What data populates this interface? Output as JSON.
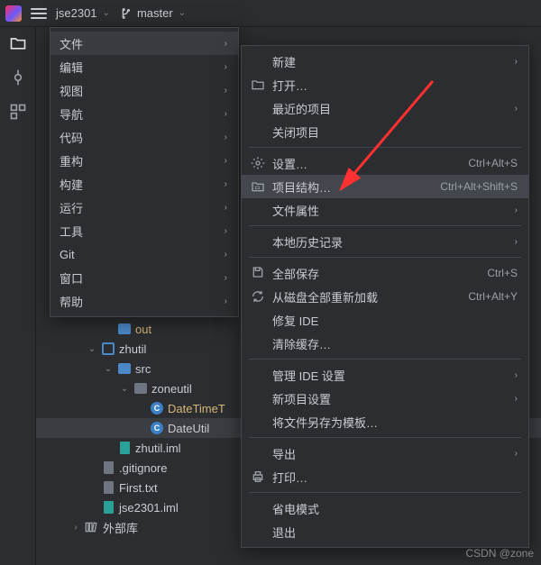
{
  "top": {
    "project": "jse2301",
    "branch": "master"
  },
  "menu1": {
    "items": [
      {
        "label": "文件",
        "arrow": true,
        "hl": true
      },
      {
        "label": "编辑",
        "arrow": true
      },
      {
        "label": "视图",
        "arrow": true
      },
      {
        "label": "导航",
        "arrow": true
      },
      {
        "label": "代码",
        "arrow": true
      },
      {
        "label": "重构",
        "arrow": true
      },
      {
        "label": "构建",
        "arrow": true
      },
      {
        "label": "运行",
        "arrow": true
      },
      {
        "label": "工具",
        "arrow": true
      },
      {
        "label": "Git",
        "arrow": true
      },
      {
        "label": "窗口",
        "arrow": true
      },
      {
        "label": "帮助",
        "arrow": true
      }
    ]
  },
  "menu2": {
    "groups": [
      [
        {
          "icon": "",
          "label": "新建",
          "arrow": true
        },
        {
          "icon": "folder",
          "label": "打开…"
        },
        {
          "icon": "",
          "label": "最近的项目",
          "arrow": true
        },
        {
          "icon": "",
          "label": "关闭项目"
        }
      ],
      [
        {
          "icon": "gear",
          "label": "设置…",
          "short": "Ctrl+Alt+S"
        },
        {
          "icon": "struct",
          "label": "项目结构…",
          "short": "Ctrl+Alt+Shift+S",
          "hl": true
        },
        {
          "icon": "",
          "label": "文件属性",
          "arrow": true
        }
      ],
      [
        {
          "icon": "",
          "label": "本地历史记录",
          "arrow": true
        }
      ],
      [
        {
          "icon": "saveall",
          "label": "全部保存",
          "short": "Ctrl+S"
        },
        {
          "icon": "reload",
          "label": "从磁盘全部重新加载",
          "short": "Ctrl+Alt+Y"
        },
        {
          "icon": "",
          "label": "修复 IDE"
        },
        {
          "icon": "",
          "label": "清除缓存…"
        }
      ],
      [
        {
          "icon": "",
          "label": "管理 IDE 设置",
          "arrow": true
        },
        {
          "icon": "",
          "label": "新项目设置",
          "arrow": true
        },
        {
          "icon": "",
          "label": "将文件另存为模板…"
        }
      ],
      [
        {
          "icon": "",
          "label": "导出",
          "arrow": true
        },
        {
          "icon": "print",
          "label": "打印…"
        }
      ],
      [
        {
          "icon": "",
          "label": "省电模式"
        },
        {
          "icon": "",
          "label": "退出"
        }
      ]
    ]
  },
  "tree": {
    "rows": [
      {
        "depth": 3,
        "arrow": "",
        "icon": "folder-blue",
        "label": "out",
        "yellow": true
      },
      {
        "depth": 2,
        "arrow": "v",
        "icon": "module",
        "label": "zhutil",
        "sel": false
      },
      {
        "depth": 3,
        "arrow": "v",
        "icon": "folder-blue",
        "label": "src"
      },
      {
        "depth": 4,
        "arrow": "v",
        "icon": "folder",
        "label": "zoneutil"
      },
      {
        "depth": 5,
        "arrow": "",
        "icon": "class",
        "label": "DateTimeT",
        "yellow": true
      },
      {
        "depth": 5,
        "arrow": "",
        "icon": "class",
        "label": "DateUtil",
        "sel": true
      },
      {
        "depth": 3,
        "arrow": "",
        "icon": "file-teal",
        "label": "zhutil.iml"
      },
      {
        "depth": 2,
        "arrow": "",
        "icon": "file-gray",
        "label": ".gitignore"
      },
      {
        "depth": 2,
        "arrow": "",
        "icon": "file-gray",
        "label": "First.txt"
      },
      {
        "depth": 2,
        "arrow": "",
        "icon": "file-teal",
        "label": "jse2301.iml"
      },
      {
        "depth": 1,
        "arrow": ">",
        "icon": "lib",
        "label": "外部库"
      }
    ]
  },
  "watermark": "CSDN @zone"
}
